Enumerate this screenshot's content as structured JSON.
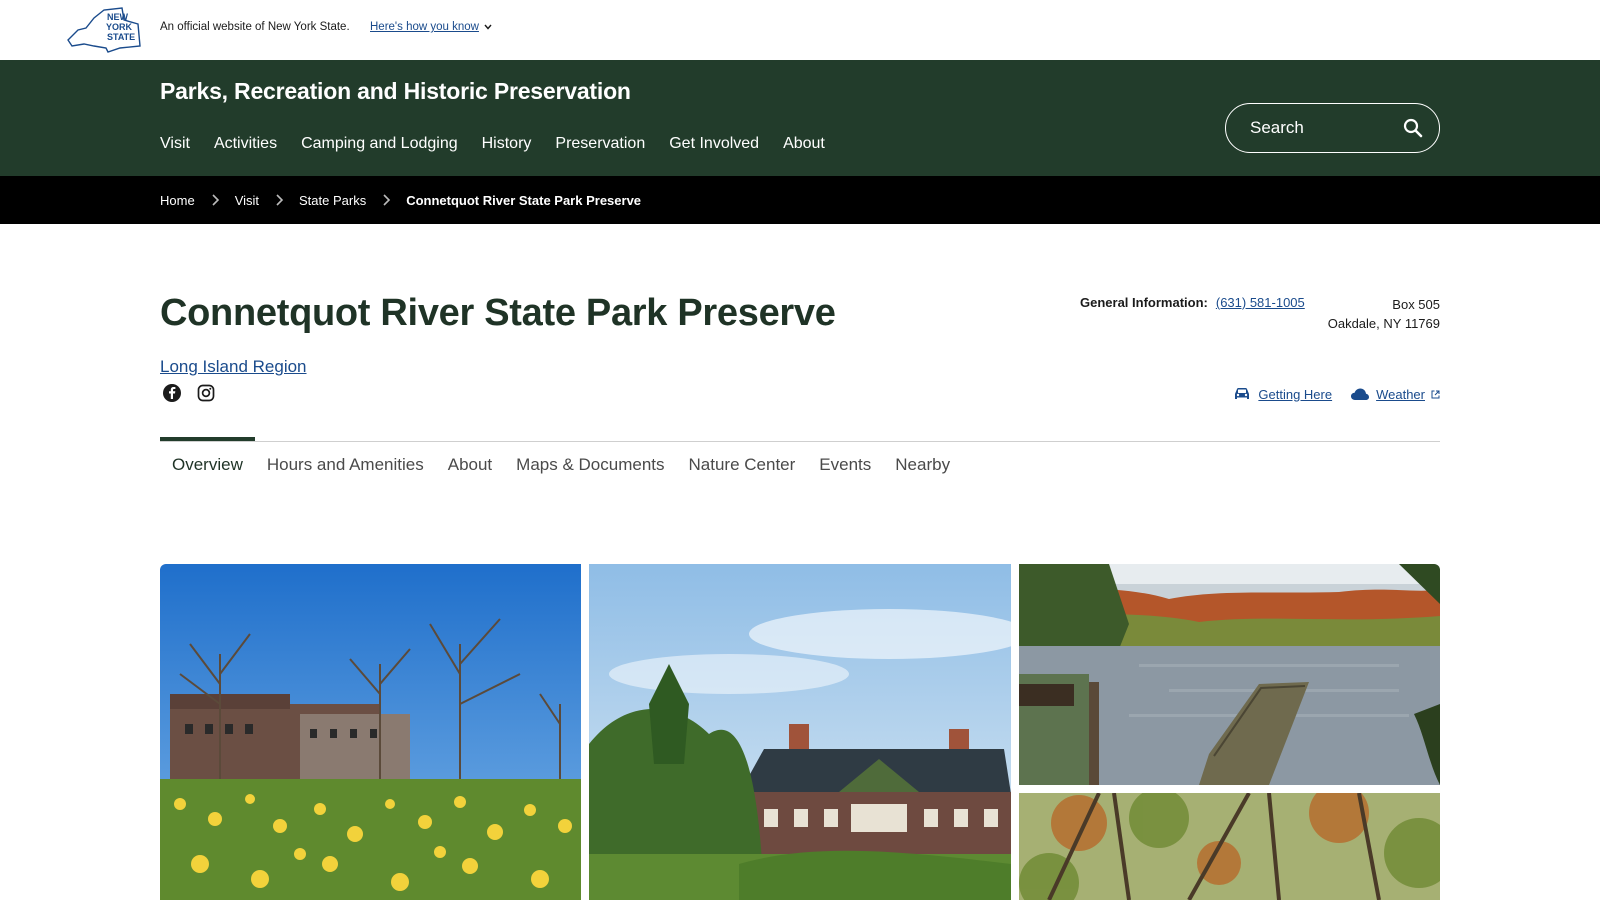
{
  "banner": {
    "logo_text": [
      "NEW",
      "YORK",
      "STATE"
    ],
    "official_text": "An official website of New York State.",
    "how_know_label": "Here's how you know"
  },
  "header": {
    "agency_title": "Parks, Recreation and Historic Preservation",
    "nav": [
      "Visit",
      "Activities",
      "Camping and Lodging",
      "History",
      "Preservation",
      "Get Involved",
      "About"
    ],
    "search_placeholder": "Search"
  },
  "breadcrumb": {
    "items": [
      "Home",
      "Visit",
      "State Parks"
    ],
    "current": "Connetquot River State Park Preserve"
  },
  "park": {
    "title": "Connetquot River State Park Preserve",
    "region": "Long Island Region",
    "social": [
      "facebook-icon",
      "instagram-icon"
    ],
    "general_info_label": "General Information:",
    "phone": "(631) 581-1005",
    "address_line1": "Box 505",
    "address_line2": "Oakdale, NY 11769",
    "getting_here": "Getting Here",
    "weather": "Weather"
  },
  "tabs": [
    "Overview",
    "Hours and Amenities",
    "About",
    "Maps & Documents",
    "Nature Center",
    "Events",
    "Nearby"
  ],
  "active_tab": "Overview",
  "colors": {
    "header_green": "#223c2b",
    "link_blue": "#1a4b8c",
    "breadcrumb_bg": "#000000"
  }
}
